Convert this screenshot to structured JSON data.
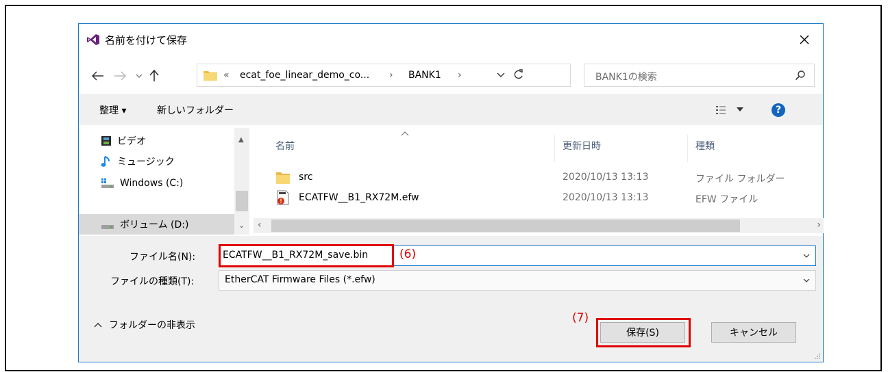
{
  "dialog": {
    "title": "名前を付けて保存"
  },
  "address": {
    "segments": [
      "«",
      "ecat_foe_linear_demo_co...",
      "›",
      "BANK1",
      "›"
    ]
  },
  "search": {
    "placeholder": "BANK1の検索"
  },
  "toolbar": {
    "organize": "整理 ▾",
    "new_folder": "新しいフォルダー"
  },
  "sidebar": {
    "items": [
      {
        "label": "ビデオ",
        "icon": "video-icon"
      },
      {
        "label": "ミュージック",
        "icon": "music-icon"
      },
      {
        "label": "Windows (C:)",
        "icon": "drive-icon"
      },
      {
        "label": "ボリューム (D:)",
        "icon": "drive-icon"
      }
    ]
  },
  "columns": {
    "name": "名前",
    "date": "更新日時",
    "type": "種類"
  },
  "files": [
    {
      "name": "src",
      "date": "2020/10/13 13:13",
      "type": "ファイル フォルダー",
      "icon": "folder-icon"
    },
    {
      "name": "ECATFW__B1_RX72M.efw",
      "date": "2020/10/13 13:13",
      "type": "EFW ファイル",
      "icon": "efw-file-icon"
    }
  ],
  "filename": {
    "label": "ファイル名(N):",
    "value": "ECATFW__B1_RX72M_save.bin"
  },
  "filetype": {
    "label": "ファイルの種類(T):",
    "value": "EtherCAT Firmware Files (*.efw)"
  },
  "annotations": {
    "a6": "(6)",
    "a7": "(7)"
  },
  "buttons": {
    "save": "保存(S)",
    "cancel": "キャンセル",
    "hide_folders": "フォルダーの非表示"
  },
  "colors": {
    "accent": "#1979ca",
    "highlight_red": "#e00000",
    "help_blue": "#1565c0",
    "folder_yellow": "#f0c040"
  }
}
